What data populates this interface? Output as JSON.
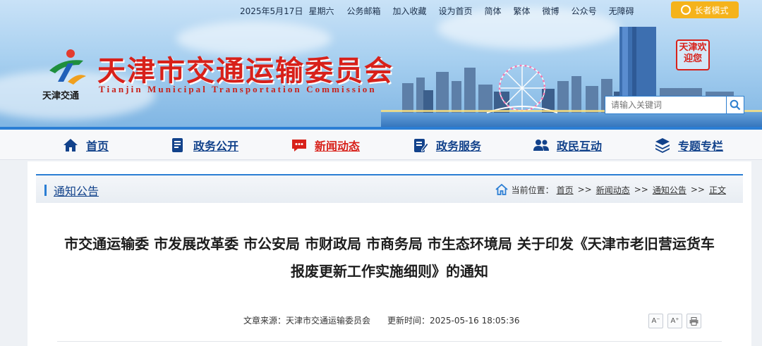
{
  "topbar": {
    "date": "2025年5月17日",
    "weekday": "星期六",
    "links": [
      "公务邮箱",
      "加入收藏",
      "设为首页",
      "简体",
      "繁体",
      "微博",
      "公众号",
      "无障碍"
    ],
    "elder_mode": "长者模式"
  },
  "site": {
    "logo_caption": "天津交通",
    "title": "天津市交通运输委员会",
    "subtitle": "Tianjin Municipal Transportation Commission",
    "seal_text": "天津欢迎您"
  },
  "search": {
    "placeholder": "请输入关键词"
  },
  "nav": [
    {
      "label": "首页",
      "icon": "home-icon"
    },
    {
      "label": "政务公开",
      "icon": "document-icon"
    },
    {
      "label": "新闻动态",
      "icon": "chat-bubble-icon",
      "active": true
    },
    {
      "label": "政务服务",
      "icon": "edit-form-icon"
    },
    {
      "label": "政民互动",
      "icon": "people-icon"
    },
    {
      "label": "专题专栏",
      "icon": "layers-icon"
    }
  ],
  "section": {
    "title": "通知公告"
  },
  "breadcrumb": {
    "prefix": "当前位置：",
    "items": [
      "首页",
      "新闻动态",
      "通知公告",
      "正文"
    ],
    "separator": ">>"
  },
  "article": {
    "title_line1": "市交通运输委 市发展改革委 市公安局 市财政局 市商务局 市生态环境局 关于印发《天津市老旧营运货车",
    "title_line2": "报废更新工作实施细则》的通知",
    "source": "文章来源：天津市交通运输委员会",
    "updated": "更新时间：2025-05-16 18:05:36"
  },
  "tools": {
    "font_smaller": "A⁻",
    "font_larger": "A⁺"
  },
  "colors": {
    "accent": "#2b7ed4",
    "brand_red": "#d8211a",
    "nav_text": "#12428b",
    "elder_btn": "#f5b31b"
  }
}
